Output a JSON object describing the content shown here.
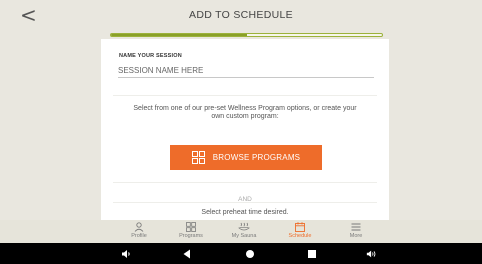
{
  "header": {
    "back_glyph": "<",
    "title": "ADD TO SCHEDULE"
  },
  "progress": {
    "fraction": 0.5,
    "fill_color": "#8aa028"
  },
  "form": {
    "session_label": "NAME YOUR SESSION",
    "session_placeholder": "SESSION NAME HERE",
    "program_text": "Select from one of our pre-set Wellness Program options, or create your own custom program:",
    "browse_label": "BROWSE PROGRAMS",
    "browse_icon": "grid-icon",
    "and_text": "AND",
    "preheat_text": "Select preheat time desired."
  },
  "tabs": [
    {
      "label": "Profile",
      "icon": "person-icon",
      "active": false
    },
    {
      "label": "Programs",
      "icon": "grid-icon",
      "active": false
    },
    {
      "label": "My Sauna",
      "icon": "sauna-icon",
      "active": false
    },
    {
      "label": "Schedule",
      "icon": "calendar-icon",
      "active": true
    },
    {
      "label": "More",
      "icon": "menu-icon",
      "active": false
    }
  ],
  "system_bar": [
    "volume-down-icon",
    "back-icon",
    "home-icon",
    "recents-icon",
    "volume-up-icon"
  ],
  "colors": {
    "accent": "#ee6c2a",
    "background": "#e9e7df",
    "progress": "#8aa028"
  }
}
